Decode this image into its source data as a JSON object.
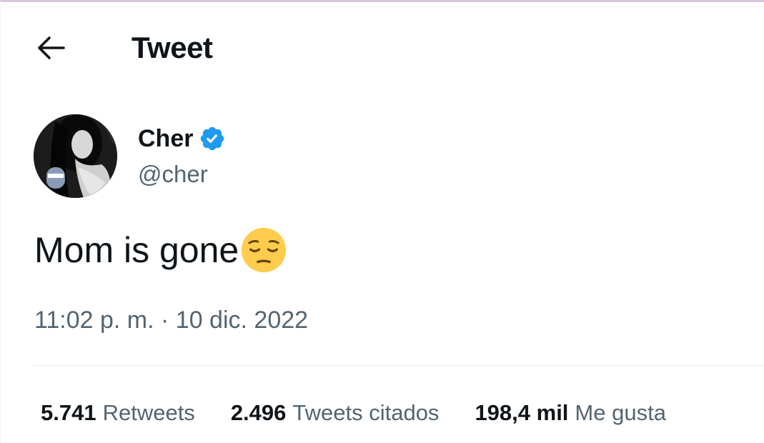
{
  "header": {
    "title": "Tweet",
    "back_icon": "arrow-left-icon"
  },
  "author": {
    "name": "Cher",
    "handle": "@cher",
    "verified": true,
    "verified_color": "#1d9bf0",
    "avatar_icon": "profile-photo"
  },
  "tweet": {
    "text": "Mom is gone",
    "emoji": "pensive-face-emoji",
    "timestamp": "11:02 p. m. · 10 dic. 2022"
  },
  "stats": [
    {
      "count": "5.741",
      "label": "Retweets"
    },
    {
      "count": "2.496",
      "label": "Tweets citados"
    },
    {
      "count": "198,4 mil",
      "label": "Me gusta"
    }
  ],
  "colors": {
    "text_primary": "#0f1419",
    "text_secondary": "#536471",
    "divider": "#e7ecee",
    "emoji_yellow": "#ffcc4d"
  }
}
